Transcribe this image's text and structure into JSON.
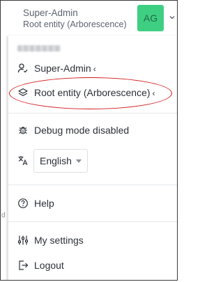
{
  "header": {
    "user_name": "Super-Admin",
    "entity": "Root entity (Arborescence)",
    "avatar_initials": "AG",
    "avatar_color": "#3fcf83",
    "dropdown_icon": "chevron-down-icon"
  },
  "menu": {
    "profile": {
      "label": "Super-Admin",
      "icon": "user-check-icon",
      "chevron": "‹"
    },
    "entity": {
      "label": "Root entity (Arborescence)",
      "icon": "layers-icon",
      "chevron": "‹"
    },
    "debug": {
      "label": "Debug mode disabled",
      "icon": "bug-icon"
    },
    "language": {
      "icon": "translate-icon",
      "selected": "English"
    },
    "help": {
      "label": "Help",
      "icon": "help-circle-icon"
    },
    "settings": {
      "label": "My settings",
      "icon": "sliders-icon"
    },
    "logout": {
      "label": "Logout",
      "icon": "logout-icon"
    }
  },
  "annotation": {
    "color": "#d11a1a"
  },
  "background_fragment": "d"
}
